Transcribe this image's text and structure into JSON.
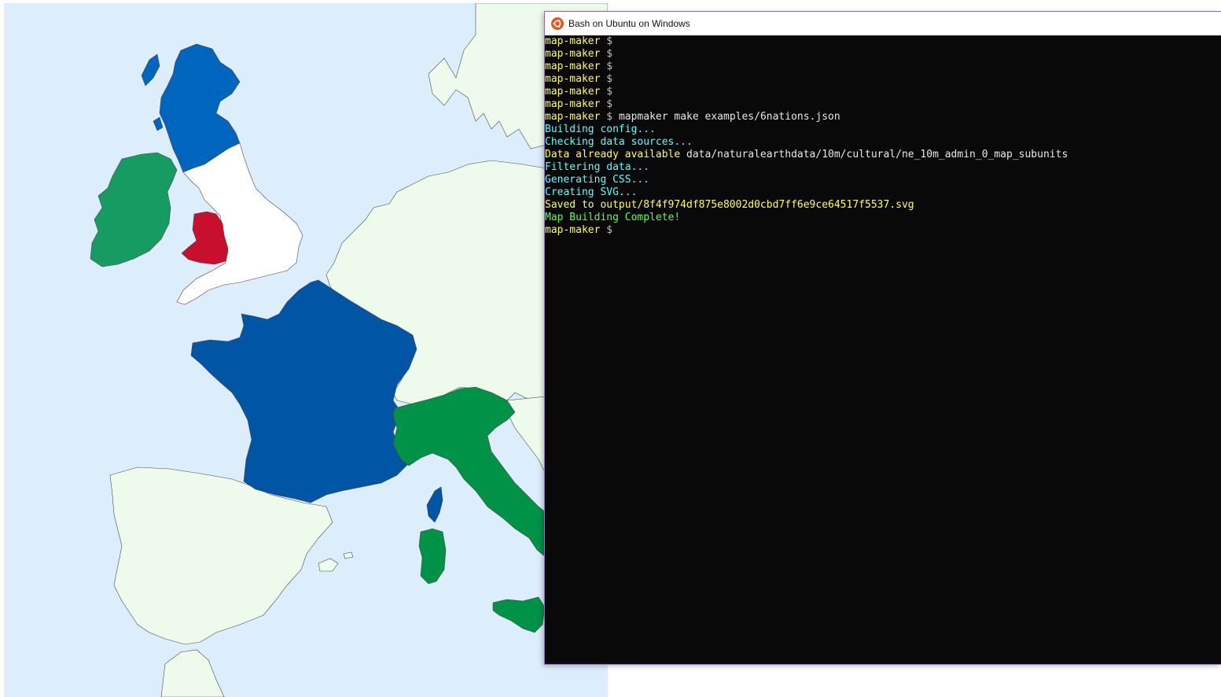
{
  "window": {
    "title": "Bash on Ubuntu on Windows",
    "icon": "ubuntu-logo-icon"
  },
  "terminal": {
    "prompt": "map-maker",
    "dollar": "$",
    "lines": [
      {
        "type": "prompt",
        "prompt": "map-maker",
        "dollar": "$",
        "command": ""
      },
      {
        "type": "prompt",
        "prompt": "map-maker",
        "dollar": "$",
        "command": ""
      },
      {
        "type": "prompt",
        "prompt": "map-maker",
        "dollar": "$",
        "command": ""
      },
      {
        "type": "prompt",
        "prompt": "map-maker",
        "dollar": "$",
        "command": ""
      },
      {
        "type": "prompt",
        "prompt": "map-maker",
        "dollar": "$",
        "command": ""
      },
      {
        "type": "prompt",
        "prompt": "map-maker",
        "dollar": "$",
        "command": ""
      },
      {
        "type": "prompt",
        "prompt": "map-maker",
        "dollar": "$",
        "command": "mapmaker make examples/6nations.json"
      },
      {
        "type": "output",
        "color": "cyan",
        "text": "Building config..."
      },
      {
        "type": "output",
        "color": "cyan",
        "text": "Checking data sources..."
      },
      {
        "type": "mixed",
        "colored": "Data already available",
        "color": "yellow",
        "rest": "data/naturalearthdata/10m/cultural/ne_10m_admin_0_map_subunits"
      },
      {
        "type": "output",
        "color": "cyan",
        "text": "Filtering data..."
      },
      {
        "type": "output",
        "color": "cyan",
        "text": "Generating CSS..."
      },
      {
        "type": "output",
        "color": "cyan",
        "text": "Creating SVG..."
      },
      {
        "type": "output",
        "color": "yellow",
        "text": "Saved to output/8f4f974df875e8002d0cbd7ff6e9ce64517f5537.svg"
      },
      {
        "type": "output",
        "color": "green",
        "text": "Map Building Complete!"
      },
      {
        "type": "prompt",
        "prompt": "map-maker",
        "dollar": "$",
        "command": ""
      }
    ]
  },
  "map": {
    "colors": {
      "sea": "#dcedfc",
      "land": "#eefbec",
      "border": "#4a4a4a",
      "scotland": "#0065bd",
      "ireland": "#169b62",
      "wales": "#c8102e",
      "england": "#ffffff",
      "france": "#0055a4",
      "italy": "#009246"
    }
  }
}
